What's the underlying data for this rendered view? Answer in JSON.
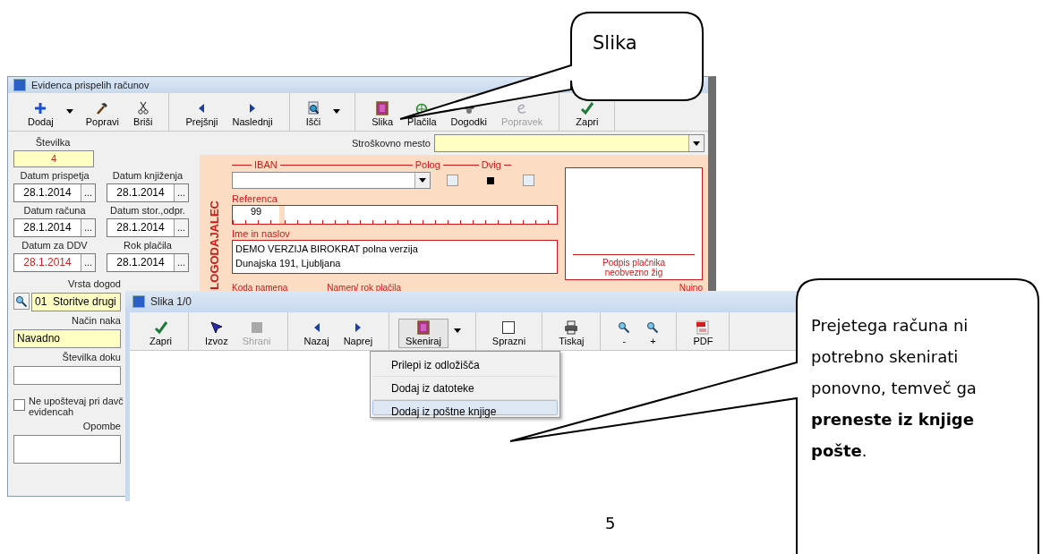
{
  "main_window": {
    "title": "Evidenca prispelih računov",
    "toolbar": [
      {
        "buttons": [
          {
            "label": "Dodaj",
            "kind": "plus",
            "dropdown": true,
            "disabled": false
          },
          {
            "label": "Popravi",
            "kind": "hammer",
            "dropdown": false,
            "disabled": false
          },
          {
            "label": "Briši",
            "kind": "scissors",
            "dropdown": false,
            "disabled": false
          }
        ]
      },
      {
        "buttons": [
          {
            "label": "Prejšnji",
            "kind": "left",
            "dropdown": false,
            "disabled": false
          },
          {
            "label": "Naslednji",
            "kind": "right",
            "dropdown": false,
            "disabled": false
          }
        ]
      },
      {
        "buttons": [
          {
            "label": "Išči",
            "kind": "find",
            "dropdown": true,
            "disabled": false
          }
        ]
      },
      {
        "buttons": [
          {
            "label": "Slika",
            "kind": "picture",
            "dropdown": false,
            "disabled": false
          },
          {
            "label": "Plačila",
            "kind": "globe",
            "dropdown": false,
            "disabled": false
          },
          {
            "label": "Dogodki",
            "kind": "events",
            "dropdown": false,
            "disabled": false
          },
          {
            "label": "Popravek",
            "kind": "edit",
            "dropdown": false,
            "disabled": true
          }
        ]
      },
      {
        "buttons": [
          {
            "label": "Zapri",
            "kind": "check",
            "dropdown": false,
            "disabled": false
          }
        ]
      }
    ],
    "left_panel": {
      "number": {
        "label": "Številka",
        "value": "4"
      },
      "date_rows": [
        {
          "fields": [
            {
              "label": "Datum prispetja",
              "value": "28.1.2014",
              "picker": "...",
              "warning": false
            },
            {
              "label": "Datum knjiženja",
              "value": "28.1.2014",
              "picker": "...",
              "warning": false
            }
          ]
        },
        {
          "fields": [
            {
              "label": "Datum računa",
              "value": "28.1.2014",
              "picker": "...",
              "warning": false
            },
            {
              "label": "Datum stor.,odpr.",
              "value": "28.1.2014",
              "picker": "...",
              "warning": false
            }
          ]
        },
        {
          "fields": [
            {
              "label": "Datum za DDV",
              "value": "28.1.2014",
              "picker": "...",
              "warning": true
            },
            {
              "label": "Rok plačila",
              "value": "28.1.2014",
              "picker": "...",
              "warning": false
            }
          ]
        }
      ],
      "event_type": {
        "label": "Vrsta dogod",
        "value": "01  Storitve drugi"
      },
      "payment_mode": {
        "label": "Način naka",
        "value": "Navadno"
      },
      "document_number": {
        "label": "Številka doku"
      },
      "tax_checkbox": {
        "label_lines": [
          "Ne upoštevaj pri davč",
          "evidencah"
        ],
        "checked": false
      },
      "notes": {
        "label": "Opombe"
      }
    },
    "cost_center": {
      "label": "Stroškovno mesto"
    },
    "form": {
      "side_label": "LOGODAJALEC",
      "iban_label": "IBAN",
      "polog": {
        "label": "Polog",
        "checked": false
      },
      "dvig": {
        "label": "Dvig",
        "checked": false
      },
      "reference": {
        "label": "Referenca",
        "value": "99"
      },
      "name_address": {
        "label": "Ime in naslov",
        "lines": [
          "DEMO VERZIJA BIROKRAT polna verzija",
          "Dunajska 191, Ljubljana"
        ]
      },
      "signature": [
        "Podpis plačnika",
        "neobvezno žig"
      ],
      "bottom_labels": [
        "Koda namena",
        "Namen/ rok plačila",
        "Nujno"
      ]
    }
  },
  "image_window": {
    "title": "Slika 1/0",
    "toolbar": [
      {
        "buttons": [
          {
            "label": "Zapri",
            "kind": "check",
            "dropdown": false,
            "disabled": false,
            "pressed": false
          }
        ]
      },
      {
        "buttons": [
          {
            "label": "Izvoz",
            "kind": "cursor",
            "dropdown": false,
            "disabled": false,
            "pressed": false
          },
          {
            "label": "Shrani",
            "kind": "square",
            "dropdown": false,
            "disabled": true,
            "pressed": false
          }
        ]
      },
      {
        "buttons": [
          {
            "label": "Nazaj",
            "kind": "left",
            "dropdown": false,
            "disabled": false,
            "pressed": false
          },
          {
            "label": "Naprej",
            "kind": "right",
            "dropdown": false,
            "disabled": false,
            "pressed": false
          }
        ]
      },
      {
        "buttons": [
          {
            "label": "Skeniraj",
            "kind": "picture",
            "dropdown": true,
            "disabled": false,
            "pressed": true
          }
        ]
      },
      {
        "buttons": [
          {
            "label": "Sprazni",
            "kind": "page",
            "dropdown": false,
            "disabled": false,
            "pressed": false
          }
        ]
      },
      {
        "buttons": [
          {
            "label": "Tiskaj",
            "kind": "printer",
            "dropdown": false,
            "disabled": false,
            "pressed": false
          }
        ]
      },
      {
        "buttons": [
          {
            "label": "-",
            "kind": "zoom",
            "dropdown": false,
            "disabled": false,
            "pressed": false
          },
          {
            "label": "+",
            "kind": "zoom",
            "dropdown": false,
            "disabled": false,
            "pressed": false
          }
        ]
      },
      {
        "buttons": [
          {
            "label": "PDF",
            "kind": "pdf",
            "dropdown": false,
            "disabled": false,
            "pressed": false
          }
        ]
      }
    ],
    "menu": [
      {
        "label": "Prilepi iz odložišča",
        "selected": false
      },
      {
        "label": "Dodaj iz datoteke",
        "selected": false
      },
      {
        "label": "Dodaj iz poštne knjige",
        "selected": true
      }
    ]
  },
  "callout_top": "Slika",
  "callout_bottom": "Prejetega računa ni potrebno skenirati ponovno, temveč ga **preneste iz knjige pošte**.",
  "page_number": "5"
}
